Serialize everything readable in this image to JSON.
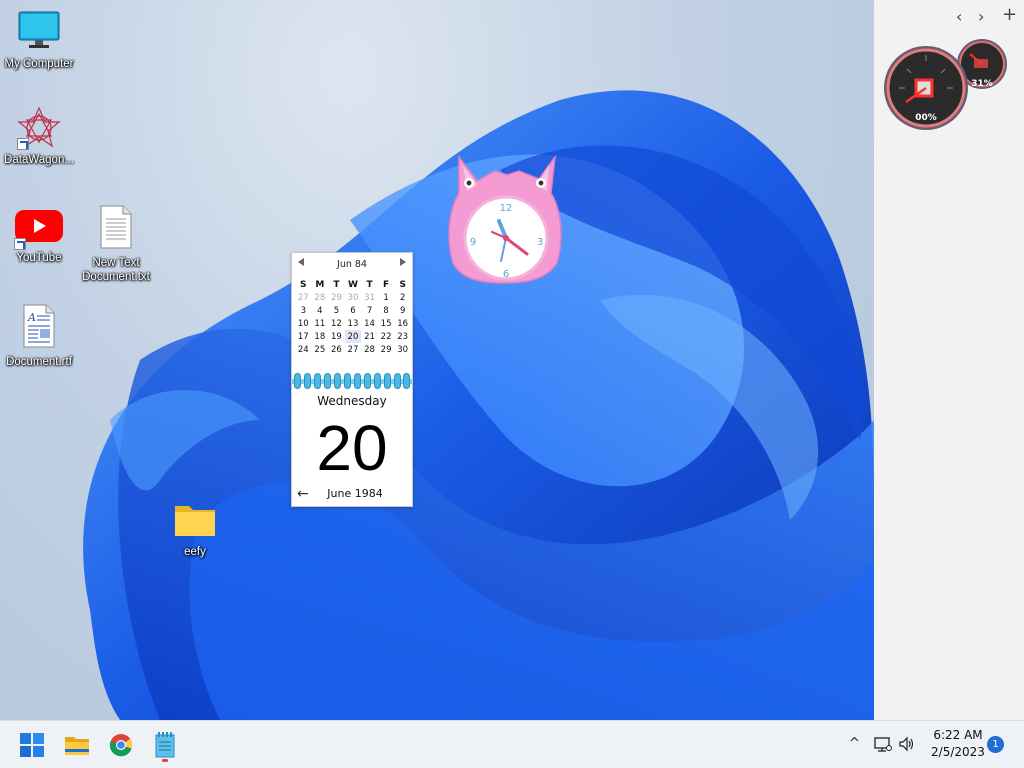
{
  "desktop": {
    "icons": [
      {
        "label": "My Computer",
        "icon": "monitor-icon"
      },
      {
        "label": "DataWagon...",
        "icon": "datawagon-icon"
      },
      {
        "label": "YouTube",
        "icon": "youtube-icon"
      },
      {
        "label": "New Text\nDocument.txt",
        "icon": "text-document-icon"
      },
      {
        "label": "Document.rtf",
        "icon": "rtf-document-icon"
      },
      {
        "label": "eefy",
        "icon": "folder-icon"
      }
    ]
  },
  "sidebar": {
    "prev": "‹",
    "next": "›",
    "add": "+",
    "meter_large": "00%",
    "meter_small": "31%"
  },
  "calendar": {
    "header": "Jun 84",
    "weekdays": [
      "S",
      "M",
      "T",
      "W",
      "T",
      "F",
      "S"
    ],
    "weeks": [
      [
        "27",
        "28",
        "29",
        "30",
        "31",
        "1",
        "2"
      ],
      [
        "3",
        "4",
        "5",
        "6",
        "7",
        "8",
        "9"
      ],
      [
        "10",
        "11",
        "12",
        "13",
        "14",
        "15",
        "16"
      ],
      [
        "17",
        "18",
        "19",
        "20",
        "21",
        "22",
        "23"
      ],
      [
        "24",
        "25",
        "26",
        "27",
        "28",
        "29",
        "30"
      ]
    ],
    "day_of_week": "Wednesday",
    "day": "20",
    "month_year": "June 1984",
    "back_arrow": "←"
  },
  "clock_gadget": {
    "numbers": [
      "12",
      "3",
      "6",
      "9"
    ]
  },
  "taskbar": {
    "apps": [
      "start-icon",
      "file-explorer-icon",
      "chrome-icon",
      "notepad-icon"
    ],
    "tray": {
      "chevron": "^",
      "time": "6:22 AM",
      "date": "2/5/2023",
      "notifications": "1"
    }
  },
  "colors": {
    "accent": "#1f6fd1",
    "wallpaper_blue": "#1a55e0",
    "calendar_rings": "#4bb9e6"
  }
}
